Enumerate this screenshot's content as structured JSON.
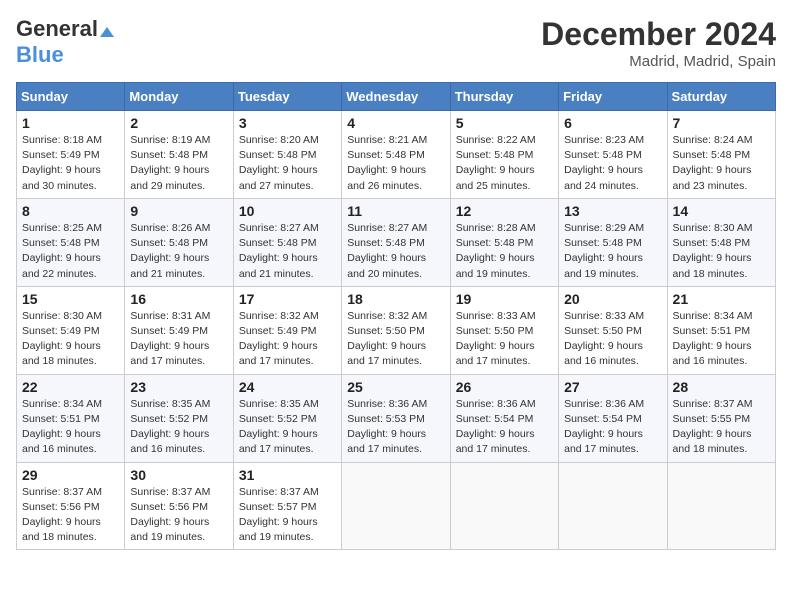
{
  "header": {
    "logo_general": "General",
    "logo_blue": "Blue",
    "title": "December 2024",
    "location": "Madrid, Madrid, Spain"
  },
  "weekdays": [
    "Sunday",
    "Monday",
    "Tuesday",
    "Wednesday",
    "Thursday",
    "Friday",
    "Saturday"
  ],
  "weeks": [
    [
      {
        "day": 1,
        "sunrise": "8:18 AM",
        "sunset": "5:49 PM",
        "daylight": "9 hours and 30 minutes."
      },
      {
        "day": 2,
        "sunrise": "8:19 AM",
        "sunset": "5:48 PM",
        "daylight": "9 hours and 29 minutes."
      },
      {
        "day": 3,
        "sunrise": "8:20 AM",
        "sunset": "5:48 PM",
        "daylight": "9 hours and 27 minutes."
      },
      {
        "day": 4,
        "sunrise": "8:21 AM",
        "sunset": "5:48 PM",
        "daylight": "9 hours and 26 minutes."
      },
      {
        "day": 5,
        "sunrise": "8:22 AM",
        "sunset": "5:48 PM",
        "daylight": "9 hours and 25 minutes."
      },
      {
        "day": 6,
        "sunrise": "8:23 AM",
        "sunset": "5:48 PM",
        "daylight": "9 hours and 24 minutes."
      },
      {
        "day": 7,
        "sunrise": "8:24 AM",
        "sunset": "5:48 PM",
        "daylight": "9 hours and 23 minutes."
      }
    ],
    [
      {
        "day": 8,
        "sunrise": "8:25 AM",
        "sunset": "5:48 PM",
        "daylight": "9 hours and 22 minutes."
      },
      {
        "day": 9,
        "sunrise": "8:26 AM",
        "sunset": "5:48 PM",
        "daylight": "9 hours and 21 minutes."
      },
      {
        "day": 10,
        "sunrise": "8:27 AM",
        "sunset": "5:48 PM",
        "daylight": "9 hours and 21 minutes."
      },
      {
        "day": 11,
        "sunrise": "8:27 AM",
        "sunset": "5:48 PM",
        "daylight": "9 hours and 20 minutes."
      },
      {
        "day": 12,
        "sunrise": "8:28 AM",
        "sunset": "5:48 PM",
        "daylight": "9 hours and 19 minutes."
      },
      {
        "day": 13,
        "sunrise": "8:29 AM",
        "sunset": "5:48 PM",
        "daylight": "9 hours and 19 minutes."
      },
      {
        "day": 14,
        "sunrise": "8:30 AM",
        "sunset": "5:48 PM",
        "daylight": "9 hours and 18 minutes."
      }
    ],
    [
      {
        "day": 15,
        "sunrise": "8:30 AM",
        "sunset": "5:49 PM",
        "daylight": "9 hours and 18 minutes."
      },
      {
        "day": 16,
        "sunrise": "8:31 AM",
        "sunset": "5:49 PM",
        "daylight": "9 hours and 17 minutes."
      },
      {
        "day": 17,
        "sunrise": "8:32 AM",
        "sunset": "5:49 PM",
        "daylight": "9 hours and 17 minutes."
      },
      {
        "day": 18,
        "sunrise": "8:32 AM",
        "sunset": "5:50 PM",
        "daylight": "9 hours and 17 minutes."
      },
      {
        "day": 19,
        "sunrise": "8:33 AM",
        "sunset": "5:50 PM",
        "daylight": "9 hours and 17 minutes."
      },
      {
        "day": 20,
        "sunrise": "8:33 AM",
        "sunset": "5:50 PM",
        "daylight": "9 hours and 16 minutes."
      },
      {
        "day": 21,
        "sunrise": "8:34 AM",
        "sunset": "5:51 PM",
        "daylight": "9 hours and 16 minutes."
      }
    ],
    [
      {
        "day": 22,
        "sunrise": "8:34 AM",
        "sunset": "5:51 PM",
        "daylight": "9 hours and 16 minutes."
      },
      {
        "day": 23,
        "sunrise": "8:35 AM",
        "sunset": "5:52 PM",
        "daylight": "9 hours and 16 minutes."
      },
      {
        "day": 24,
        "sunrise": "8:35 AM",
        "sunset": "5:52 PM",
        "daylight": "9 hours and 17 minutes."
      },
      {
        "day": 25,
        "sunrise": "8:36 AM",
        "sunset": "5:53 PM",
        "daylight": "9 hours and 17 minutes."
      },
      {
        "day": 26,
        "sunrise": "8:36 AM",
        "sunset": "5:54 PM",
        "daylight": "9 hours and 17 minutes."
      },
      {
        "day": 27,
        "sunrise": "8:36 AM",
        "sunset": "5:54 PM",
        "daylight": "9 hours and 17 minutes."
      },
      {
        "day": 28,
        "sunrise": "8:37 AM",
        "sunset": "5:55 PM",
        "daylight": "9 hours and 18 minutes."
      }
    ],
    [
      {
        "day": 29,
        "sunrise": "8:37 AM",
        "sunset": "5:56 PM",
        "daylight": "9 hours and 18 minutes."
      },
      {
        "day": 30,
        "sunrise": "8:37 AM",
        "sunset": "5:56 PM",
        "daylight": "9 hours and 19 minutes."
      },
      {
        "day": 31,
        "sunrise": "8:37 AM",
        "sunset": "5:57 PM",
        "daylight": "9 hours and 19 minutes."
      },
      null,
      null,
      null,
      null
    ]
  ]
}
